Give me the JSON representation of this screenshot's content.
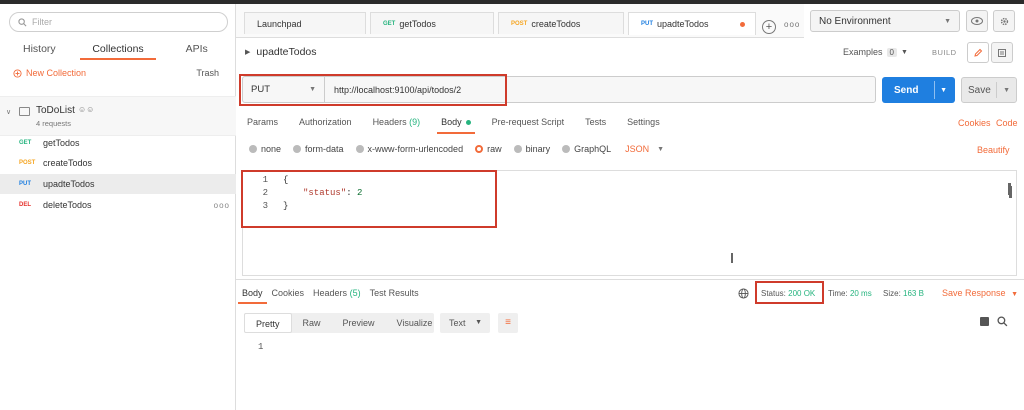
{
  "sidebar": {
    "filter_placeholder": "Filter",
    "tabs": [
      {
        "label": "History"
      },
      {
        "label": "Collections"
      },
      {
        "label": "APIs"
      }
    ],
    "new_collection": "New Collection",
    "trash": "Trash",
    "collection": {
      "name": "ToDoList",
      "subtitle": "4 requests"
    },
    "requests": [
      {
        "method": "GET",
        "name": "getTodos",
        "color": "#26b47f"
      },
      {
        "method": "POST",
        "name": "createTodos",
        "color": "#f5a623"
      },
      {
        "method": "PUT",
        "name": "upadteTodos",
        "color": "#1f7fe0"
      },
      {
        "method": "DEL",
        "name": "deleteTodos",
        "color": "#e5322d"
      }
    ],
    "more": "ooo"
  },
  "request_tabs": [
    {
      "method": "",
      "label": "Launchpad"
    },
    {
      "method": "GET",
      "label": "getTodos"
    },
    {
      "method": "POST",
      "label": "createTodos"
    },
    {
      "method": "PUT",
      "label": "upadteTodos"
    }
  ],
  "tab_more": "ooo",
  "environment": "No Environment",
  "request": {
    "title": "upadteTodos",
    "examples_label": "Examples",
    "examples_count": "0",
    "build": "BUILD",
    "method": "PUT",
    "url": "http://localhost:9100/api/todos/2",
    "send": "Send",
    "save": "Save"
  },
  "param_tabs": {
    "params": "Params",
    "authorization": "Authorization",
    "headers": "Headers",
    "headers_count": "(9)",
    "body": "Body",
    "prerequest": "Pre-request Script",
    "tests": "Tests",
    "settings": "Settings"
  },
  "cookies": "Cookies",
  "code": "Code",
  "body_options": [
    "none",
    "form-data",
    "x-www-form-urlencoded",
    "raw",
    "binary",
    "GraphQL"
  ],
  "body_format": "JSON",
  "beautify": "Beautify",
  "editor": {
    "line_numbers": [
      "1",
      "2",
      "3"
    ],
    "open_brace": "{",
    "key": "\"status\"",
    "colon": ": ",
    "value": "2",
    "close_brace": "}"
  },
  "response": {
    "tabs": {
      "body": "Body",
      "cookies": "Cookies",
      "headers": "Headers",
      "headers_count": "(5)",
      "tests": "Test Results"
    },
    "status_label": "Status:",
    "status_value": "200 OK",
    "time_label": "Time:",
    "time_value": "20 ms",
    "size_label": "Size:",
    "size_value": "163 B",
    "save_response": "Save Response",
    "views": [
      "Pretty",
      "Raw",
      "Preview",
      "Visualize"
    ],
    "text_format": "Text",
    "line": "1"
  }
}
